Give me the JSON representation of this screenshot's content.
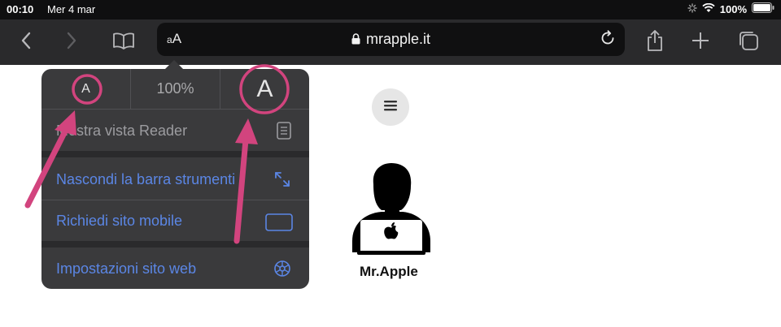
{
  "status_bar": {
    "time": "00:10",
    "date": "Mer 4 mar",
    "battery": "100%"
  },
  "toolbar": {
    "text_size_button": {
      "small": "A",
      "big": "A",
      "small_prefix": "a"
    },
    "url_host": "mrapple.it",
    "icons": [
      "back-icon",
      "forward-icon",
      "bookmarks-icon",
      "lock-icon",
      "reload-icon",
      "share-icon",
      "add-tab-icon",
      "tabs-icon"
    ]
  },
  "popover": {
    "zoom": {
      "decrease_label": "A",
      "level": "100%",
      "increase_label": "A"
    },
    "items": [
      {
        "label": "Mostra vista Reader",
        "icon": "reader-icon"
      },
      {
        "label": "Nascondi la barra strumenti",
        "icon": "expand-icon"
      },
      {
        "label": "Richiedi sito mobile",
        "icon": "mobile-site-icon"
      },
      {
        "label": "Impostazioni sito web",
        "icon": "gear-icon"
      }
    ]
  },
  "page": {
    "logo_text": "Mr.Apple",
    "menu_icon": "hamburger-icon"
  },
  "colors": {
    "accent_blue": "#5b86e5",
    "annotation_pink": "#d2447e",
    "popover_bg": "#3a3a3c",
    "toolbar_bg": "#2a2a2c"
  }
}
